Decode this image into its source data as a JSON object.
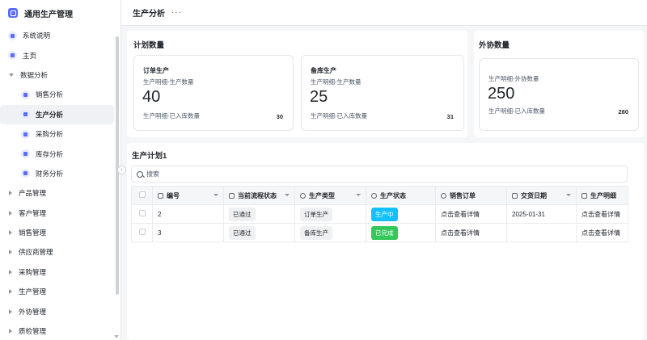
{
  "app": {
    "title": "通用生产管理"
  },
  "sidebar": {
    "items": [
      {
        "label": "系统说明"
      },
      {
        "label": "主页"
      },
      {
        "label": "数据分析"
      },
      {
        "label": "销售分析"
      },
      {
        "label": "生产分析"
      },
      {
        "label": "采购分析"
      },
      {
        "label": "库存分析"
      },
      {
        "label": "财务分析"
      },
      {
        "label": "产品管理"
      },
      {
        "label": "客户管理"
      },
      {
        "label": "销售管理"
      },
      {
        "label": "供应商管理"
      },
      {
        "label": "采购管理"
      },
      {
        "label": "生产管理"
      },
      {
        "label": "外协管理"
      },
      {
        "label": "质检管理"
      }
    ]
  },
  "header": {
    "title": "生产分析",
    "more": "···"
  },
  "plan_panel": {
    "title": "计划数量",
    "cards": [
      {
        "title": "订单生产",
        "subtitle": "生产明细-生产数量",
        "value": "40",
        "foot_label": "生产明细-已入库数量",
        "foot_value": "30"
      },
      {
        "title": "备库生产",
        "subtitle": "生产明细-生产数量",
        "value": "25",
        "foot_label": "生产明细-已入库数量",
        "foot_value": "31"
      }
    ]
  },
  "outsource_panel": {
    "title": "外协数量",
    "card": {
      "subtitle": "生产明细-外协数量",
      "value": "250",
      "foot_label": "生产明细-已入库数量",
      "foot_value": "280"
    }
  },
  "table_panel": {
    "title": "生产计划1",
    "search_placeholder": "搜索",
    "columns": [
      "编号",
      "当前流程状态",
      "生产类型",
      "生产状态",
      "销售订单",
      "交货日期",
      "生产明细"
    ],
    "rows": [
      {
        "id": "2",
        "flow": "已通过",
        "type": "订单生产",
        "status": "生产中",
        "order": "点击查看详情",
        "date": "2025-01-31",
        "detail": "点击查看详情"
      },
      {
        "id": "3",
        "flow": "已通过",
        "type": "备库生产",
        "status": "已完成",
        "order": "点击查看详情",
        "date": "",
        "detail": "点击查看详情"
      }
    ]
  },
  "colors": {
    "accent": "#5b6cff",
    "status_in_progress": "#14c0ff",
    "status_done": "#34c759"
  },
  "icons": [
    "app-logo-icon",
    "doc-icon",
    "home-icon",
    "chart-icon",
    "search-icon",
    "chevron-left-icon"
  ]
}
